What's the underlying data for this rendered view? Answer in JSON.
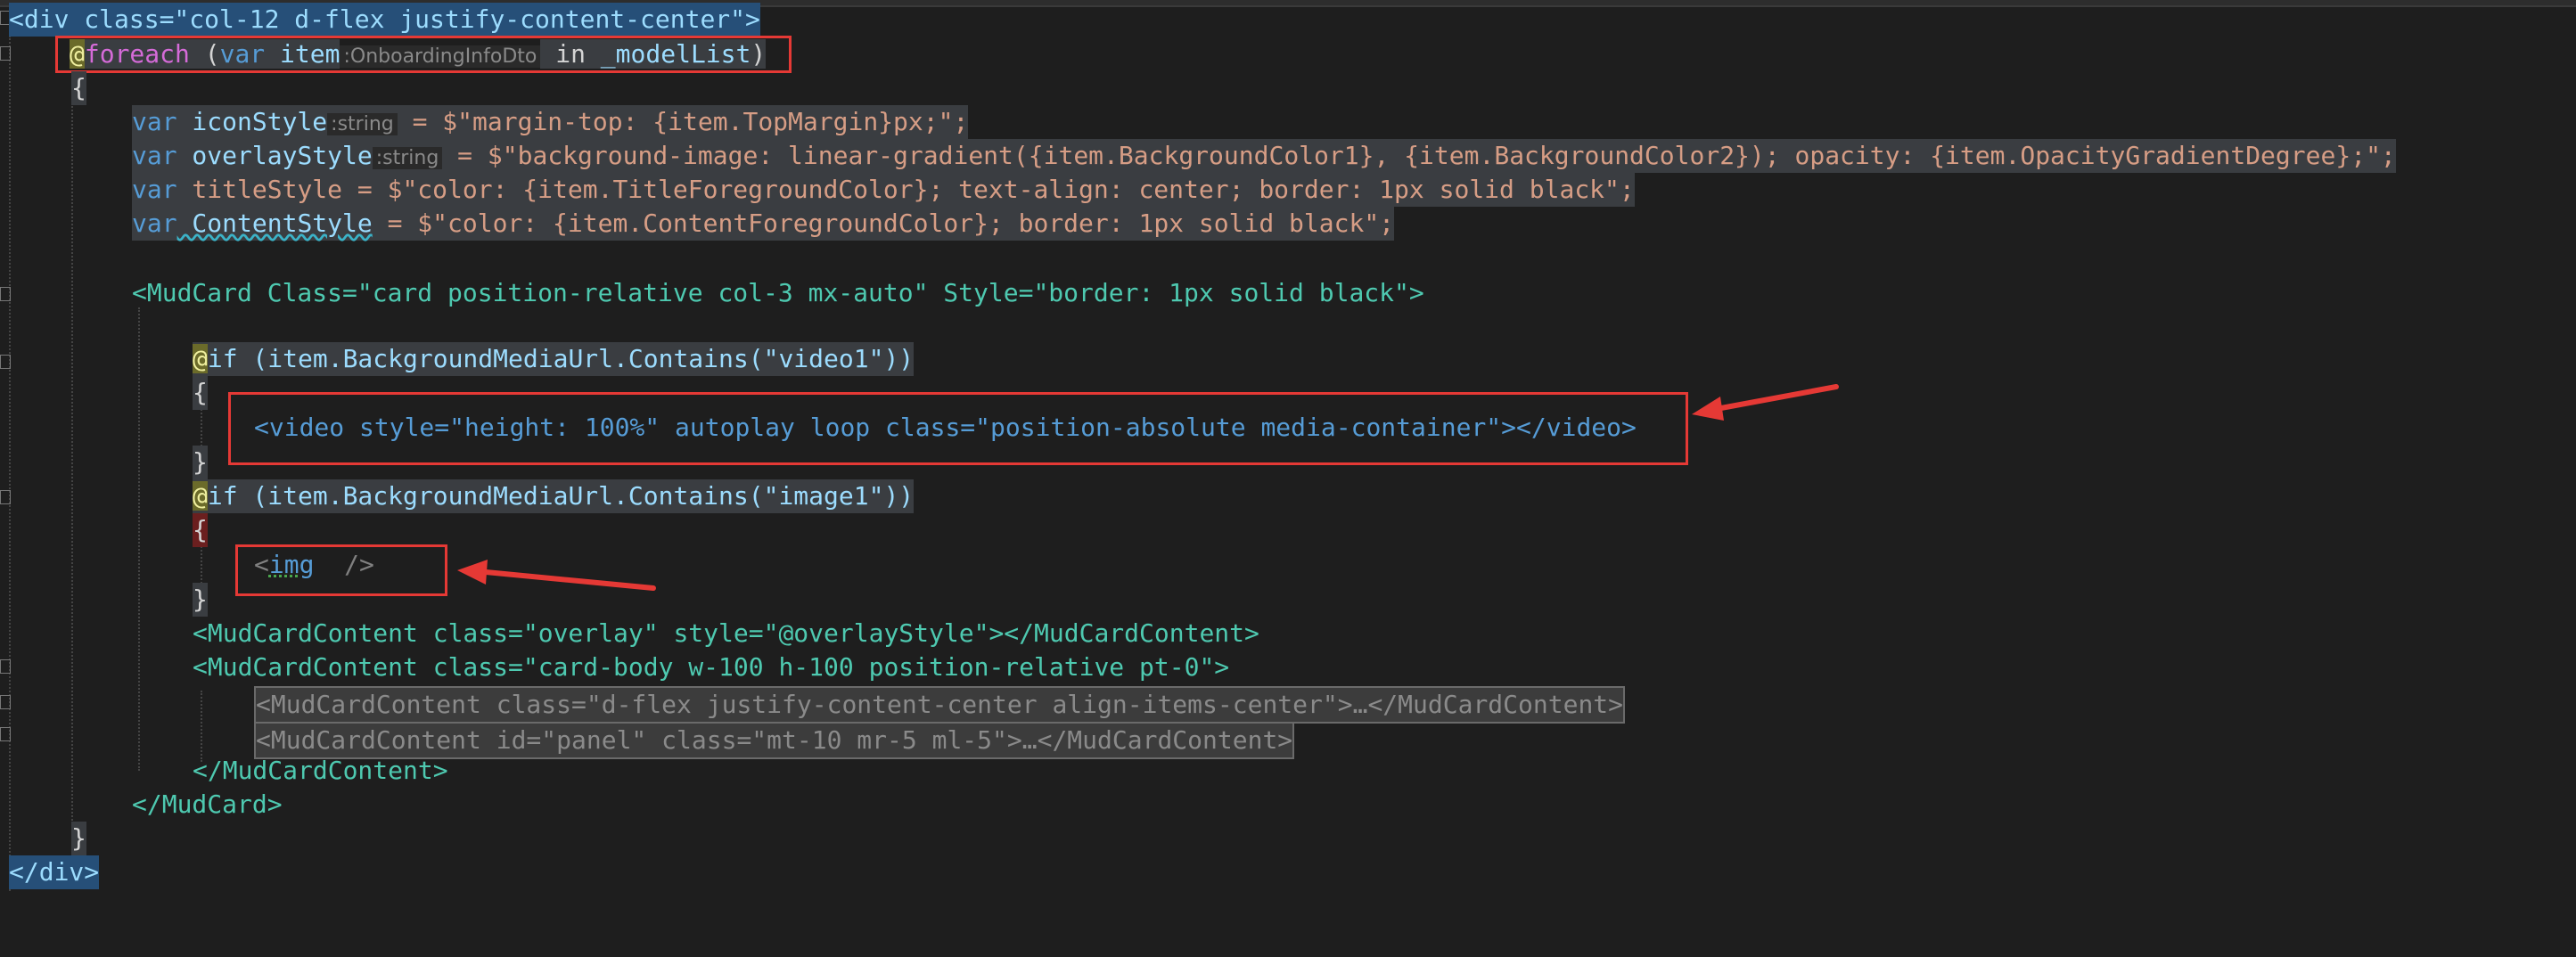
{
  "editor": {
    "language": "razor",
    "lines": {
      "l1_text": "<div class=\"col-12 d-flex justify-content-center\">",
      "l2_at": "@",
      "l2_foreach": "foreach",
      "l2_open": " (",
      "l2_var": "var",
      "l2_item": " item",
      "l2_hint": ":OnboardingInfoDto",
      "l2_in": " in ",
      "l2_model": "_modelList",
      "l2_close": ")",
      "l3": "{",
      "l4_var": "var",
      "l4_name": " iconStyle",
      "l4_hint": ":string",
      "l4_rest": " = $\"margin-top: {item.TopMargin}px;\";",
      "l5_var": "var",
      "l5_name": " overlayStyle",
      "l5_hint": ":string",
      "l5_rest": " = $\"background-image: linear-gradient({item.BackgroundColor1}, {item.BackgroundColor2}); opacity: {item.OpacityGradientDegree};\";",
      "l6_var": "var",
      "l6_rest": " titleStyle = $\"color: {item.TitleForegroundColor}; text-align: center; border: 1px solid black\";",
      "l7_var": "var",
      "l7_name": " ContentStyle",
      "l7_rest": " = $\"color: {item.ContentForegroundColor}; border: 1px solid black\";",
      "l8_text": "<MudCard Class=\"card position-relative col-3 mx-auto\" Style=\"border: 1px solid black\">",
      "l9_at": "@",
      "l9_rest": "if (item.BackgroundMediaUrl.Contains(\"video1\"))",
      "l10": "{",
      "l11_text": "<video style=\"height: 100%\" autoplay loop class=\"position-absolute media-container\"></video>",
      "l12": "}",
      "l13_at": "@",
      "l13_rest": "if (item.BackgroundMediaUrl.Contains(\"image1\"))",
      "l14": "{",
      "l15_lt": "<",
      "l15_img": "img",
      "l15_end": "  />",
      "l16": "}",
      "l17_text": "<MudCardContent class=\"overlay\" style=\"@overlayStyle\"></MudCardContent>",
      "l18_text": "<MudCardContent class=\"card-body w-100 h-100 position-relative pt-0\">",
      "l19_text": "<MudCardContent class=\"d-flex justify-content-center align-items-center\">…</MudCardContent>",
      "l20_text": "<MudCardContent id=\"panel\" class=\"mt-10 mr-5 ml-5\">…</MudCardContent>",
      "l21_text": "</MudCardContent>",
      "l22_text": "</MudCard>",
      "l23": "}",
      "l24_text": "</div>"
    }
  },
  "colors": {
    "background": "#1e1e1e",
    "keyword": "#569cd6",
    "component": "#4ec9b0",
    "string": "#d69d85",
    "property": "#d56bd8",
    "annotation_red": "#e53935"
  }
}
